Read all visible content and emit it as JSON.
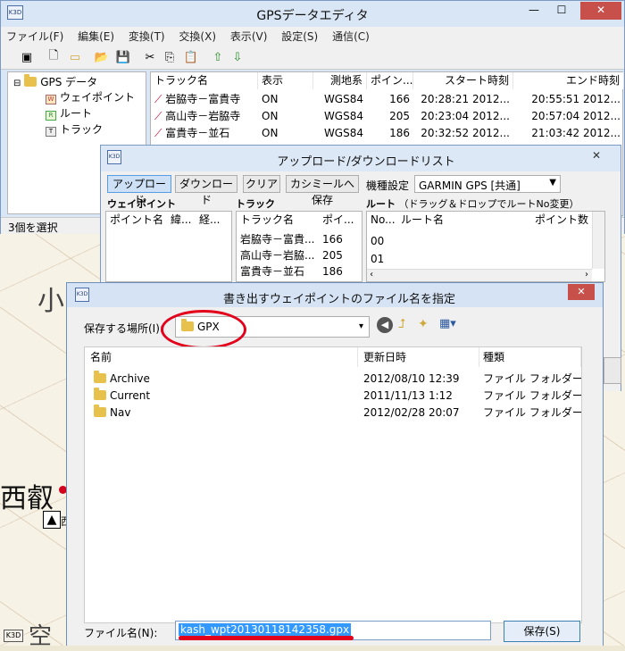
{
  "main_window": {
    "title": "GPSデータエディタ",
    "menu": [
      "ファイル(F)",
      "編集(E)",
      "変換(T)",
      "交換(X)",
      "表示(V)",
      "設定(S)",
      "通信(C)"
    ],
    "tree": {
      "root": "GPS データ",
      "children": [
        "ウェイポイント",
        "ルート",
        "トラック"
      ]
    },
    "status": "3個を選択",
    "columns": [
      "トラック名",
      "表示",
      "測地系",
      "ポイン...",
      "スタート時刻",
      "エンド時刻"
    ],
    "rows": [
      {
        "name": "岩脇寺－富貴寺",
        "display": "ON",
        "datum": "WGS84",
        "points": "166",
        "start": "20:28:21 2012...",
        "end": "20:55:51 2012..."
      },
      {
        "name": "高山寺－岩脇寺",
        "display": "ON",
        "datum": "WGS84",
        "points": "205",
        "start": "20:23:04 2012...",
        "end": "20:57:04 2012..."
      },
      {
        "name": "富貴寺－並石",
        "display": "ON",
        "datum": "WGS84",
        "points": "186",
        "start": "20:32:52 2012...",
        "end": "21:03:42 2012..."
      }
    ]
  },
  "updown_dialog": {
    "title": "アップロード/ダウンロードリスト",
    "buttons": {
      "upload": "アップロード",
      "download": "ダウンロード",
      "clear": "クリア",
      "save_kashmir": "カシミールへ保存"
    },
    "model_label": "機種設定",
    "model_value": "GARMIN GPS [共通]",
    "waypoint_header": "ウェイポイント",
    "track_header": "トラック",
    "route_header": "ルート",
    "route_note": "（ドラッグ＆ドロップでルートNo変更）",
    "waypoint_cols": [
      "ポイント名",
      "緯...",
      "経..."
    ],
    "track_cols": [
      "トラック名",
      "ポイ..."
    ],
    "tracks": [
      {
        "name": "岩脇寺－富貴...",
        "points": "166"
      },
      {
        "name": "高山寺－岩脇...",
        "points": "205"
      },
      {
        "name": "富貴寺－並石",
        "points": "186"
      }
    ],
    "route_cols": [
      "No...",
      "ルート名",
      "ポイント数"
    ],
    "routes": [
      {
        "no": "00"
      },
      {
        "no": "01"
      }
    ]
  },
  "save_dialog": {
    "title": "書き出すウェイポイントのファイル名を指定",
    "save_in_label": "保存する場所(I):",
    "save_in_value": "GPX",
    "columns": [
      "名前",
      "更新日時",
      "種類"
    ],
    "files": [
      {
        "name": "Archive",
        "date": "2012/08/10 12:39",
        "type": "ファイル フォルダー"
      },
      {
        "name": "Current",
        "date": "2011/11/13 1:12",
        "type": "ファイル フォルダー"
      },
      {
        "name": "Nav",
        "date": "2012/02/28 20:07",
        "type": "ファイル フォルダー"
      }
    ],
    "filename_label": "ファイル名(N):",
    "filename_value": "kash_wpt20130118142358.gpx",
    "save_button": "保存(S)",
    "close_glyph": "✕"
  },
  "map_labels": {
    "kanji1": "西叡",
    "kanji2": "小",
    "kanji3": "空",
    "kanji4": "西"
  },
  "icons": {
    "app": "app-logo-icon"
  },
  "colors": {
    "annotation_red": "#e3001b",
    "selection_blue": "#3399ff",
    "close_red": "#c7504b"
  }
}
